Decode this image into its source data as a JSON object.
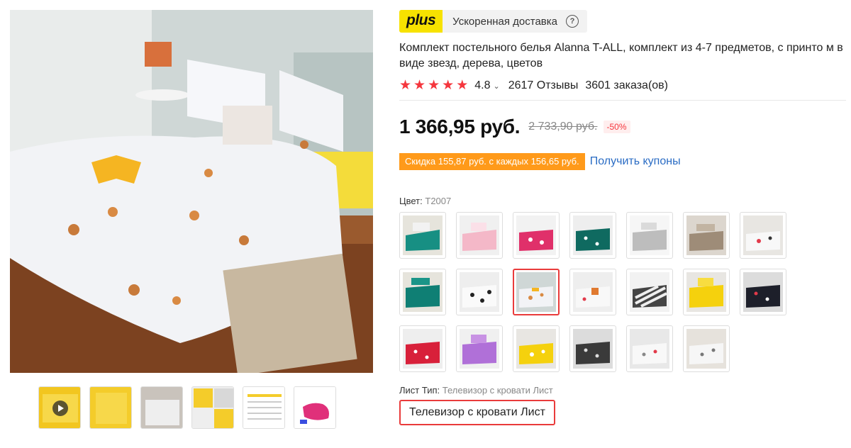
{
  "delivery": {
    "badge": "plus",
    "text": "Ускоренная доставка",
    "help_icon": "question-circle-icon"
  },
  "product": {
    "title": "Комплект постельного белья Alanna T-ALL, комплект из 4-7 предметов, с принто м в виде звезд, дерева, цветов"
  },
  "rating": {
    "stars": 5,
    "value": "4.8",
    "reviews": "2617 Отзывы",
    "orders": "3601 заказа(ов)"
  },
  "price": {
    "current": "1 366,95 руб.",
    "old": "2 733,90 руб.",
    "discount": "-50%"
  },
  "coupon": {
    "badge": "Скидка 155,87 руб. с каждых 156,65 руб.",
    "link": "Получить купоны"
  },
  "color": {
    "label": "Цвет:",
    "value": "T2007",
    "selected_index": 9
  },
  "sheet": {
    "label": "Лист Тип:",
    "value": "Телевизор с кровати Лист",
    "option": "Телевизор с кровати Лист"
  },
  "colors": {
    "accent": "#e93b3b",
    "star": "#f5363d",
    "coupon": "#ff9a1a",
    "link": "#2a6cc4",
    "plus": "#f7e200"
  }
}
